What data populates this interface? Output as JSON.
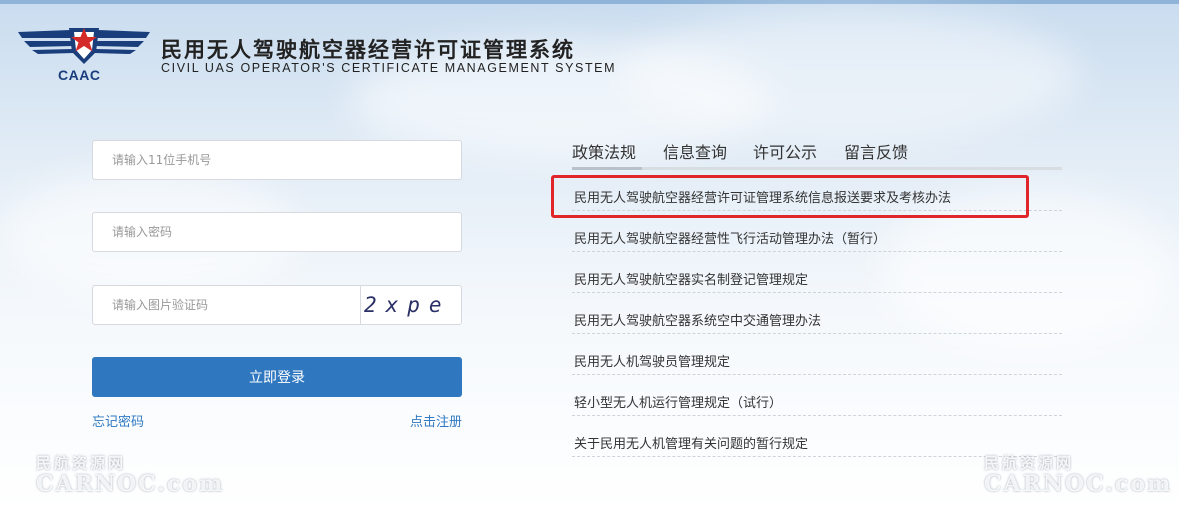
{
  "header": {
    "logo_text": "CAAC",
    "title_cn": "民用无人驾驶航空器经营许可证管理系统",
    "title_en": "CIVIL UAS OPERATOR'S CERTIFICATE MANAGEMENT SYSTEM"
  },
  "login": {
    "phone_placeholder": "请输入11位手机号",
    "password_placeholder": "请输入密码",
    "captcha_placeholder": "请输入图片验证码",
    "captcha_text": "2xpe",
    "login_button": "立即登录",
    "forgot_link": "忘记密码",
    "register_link": "点击注册"
  },
  "tabs": [
    {
      "label": "政策法规",
      "active": true
    },
    {
      "label": "信息查询",
      "active": false
    },
    {
      "label": "许可公示",
      "active": false
    },
    {
      "label": "留言反馈",
      "active": false
    }
  ],
  "news": [
    "民用无人驾驶航空器经营许可证管理系统信息报送要求及考核办法",
    "民用无人驾驶航空器经营性飞行活动管理办法（暂行）",
    "民用无人驾驶航空器实名制登记管理规定",
    "民用无人驾驶航空器系统空中交通管理办法",
    "民用无人机驾驶员管理规定",
    "轻小型无人机运行管理规定（试行）",
    "关于民用无人机管理有关问题的暂行规定"
  ],
  "watermark": {
    "cn": "民航资源网",
    "en": "CARNOC.com"
  },
  "colors": {
    "primary_button": "#2f78c0",
    "link": "#2e79c1",
    "highlight": "#e0262b",
    "logo_blue": "#1a3d7c",
    "logo_star": "#d42a2a"
  },
  "icons": [
    "caac-logo-icon"
  ]
}
